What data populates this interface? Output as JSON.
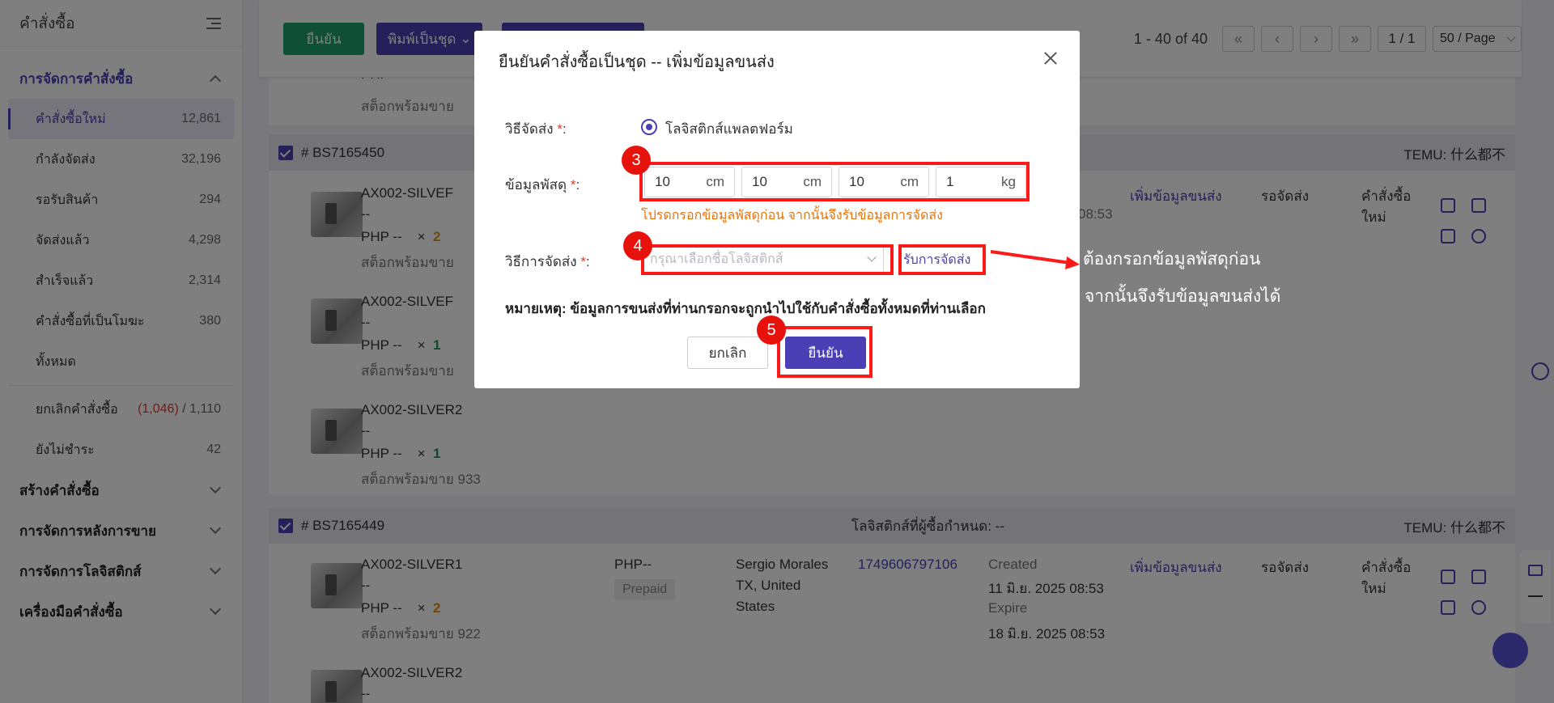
{
  "sidebar": {
    "title": "คำสั่งซื้อ",
    "active_group": "การจัดการคำสั่งซื้อ",
    "items": [
      {
        "label": "คำสั่งซื้อใหม่",
        "count": "12,861"
      },
      {
        "label": "กำลังจัดส่ง",
        "count": "32,196"
      },
      {
        "label": "รอรับสินค้า",
        "count": "294"
      },
      {
        "label": "จัดส่งแล้ว",
        "count": "4,298"
      },
      {
        "label": "สำเร็จแล้ว",
        "count": "2,314"
      },
      {
        "label": "คำสั่งซื้อที่เป็นโมฆะ",
        "count": "380"
      },
      {
        "label": "ทั้งหมด",
        "count": ""
      }
    ],
    "cancel": {
      "label": "ยกเลิกคำสั่งซื้อ",
      "pending": "(1,046)",
      "sep": "/",
      "total": "1,110"
    },
    "unpaid": {
      "label": "ยังไม่ชำระ",
      "count": "42"
    },
    "groups": [
      "สร้างคำสั่งซื้อ",
      "การจัดการหลังการขาย",
      "การจัดการโลจิสติกส์",
      "เครื่องมือคำสั่งซื้อ"
    ]
  },
  "toolbar": {
    "confirm": "ยืนยัน",
    "print_batch": "พิมพ์เป็นชุด",
    "range": "1 - 40 of 40",
    "page": "1 / 1",
    "page_size": "50 / Page"
  },
  "orders": [
    {
      "id": "# BS7165450",
      "platform": "TEMU: 什么都不"
    },
    {
      "id": "# BS7165449",
      "platform": "TEMU: 什么都不",
      "logistics": "โลจิสติกส์ที่ผู้ซื้อกำหนด: --"
    }
  ],
  "rows": {
    "sku1": "AX002-SILVER1",
    "sku2": "AX002-SILVER2",
    "sku1_cut": "AX002-SILVEF",
    "sku2_cut": "AX002-SILVEF",
    "dash": "--",
    "price": "PHP --",
    "times": "×",
    "qty2": "2",
    "qty1": "1",
    "stock_cut": "สต็อกพร้อมขาย",
    "stock_933": "สต็อกพร้อมขาย 933",
    "stock_922": "สต็อกพร้อมขาย 922",
    "add_shipping": "เพิ่มข้อมูลขนส่ง",
    "status": "รอจัดส่ง",
    "new_order_l1": "คำสั่งซื้อ",
    "new_order_l2": "ใหม่",
    "time_cut": "08:53",
    "payment": "PHP--",
    "prepaid": "Prepaid",
    "buyer_l1": "Sergio Morales",
    "buyer_l2": "TX, United",
    "buyer_l3": "States",
    "tracking": "1749606797106",
    "created_label": "Created",
    "created": "11 มิ.ย. 2025 08:53",
    "expire_label": "Expire",
    "expire": "18 มิ.ย. 2025 08:53"
  },
  "modal": {
    "title": "ยืนยันคำสั่งซื้อเป็นชุด -- เพิ่มข้อมูลขนส่ง",
    "ship_method_label": "วิธีจัดส่ง",
    "ship_method_value": "โลจิสติกส์แพลตฟอร์ม",
    "parcel_label": "ข้อมูลพัสดุ",
    "dims": [
      {
        "value": "10",
        "unit": "cm"
      },
      {
        "value": "10",
        "unit": "cm"
      },
      {
        "value": "10",
        "unit": "cm"
      },
      {
        "value": "1",
        "unit": "kg"
      }
    ],
    "hint": "โปรดกรอกข้อมูลพัสดุก่อน จากนั้นจึงรับข้อมูลการจัดส่ง",
    "delivery_label": "วิธีการจัดส่ง",
    "delivery_placeholder": "กรุณาเลือกชื่อโลจิสติกส์",
    "get_delivery": "รับการจัดส่ง",
    "note": "หมายเหตุ: ข้อมูลการขนส่งที่ท่านกรอกจะถูกนำไปใช้กับคำสั่งซื้อทั้งหมดที่ท่านเลือก",
    "cancel": "ยกเลิก",
    "confirm": "ยืนยัน",
    "required_mark": "*",
    "colon": ":"
  },
  "annotations": {
    "step3": "3",
    "step4": "4",
    "step5": "5",
    "callout_l1": "ต้องกรอกข้อมูลพัสดุก่อน",
    "callout_l2": "จากนั้นจึงรับข้อมูลขนส่งได้",
    "box_color": "#ff1a1a"
  },
  "colors": {
    "accent": "#4b3fb5",
    "green": "#1e9e6a",
    "warning": "#e3740c",
    "danger": "#e03b2f"
  }
}
